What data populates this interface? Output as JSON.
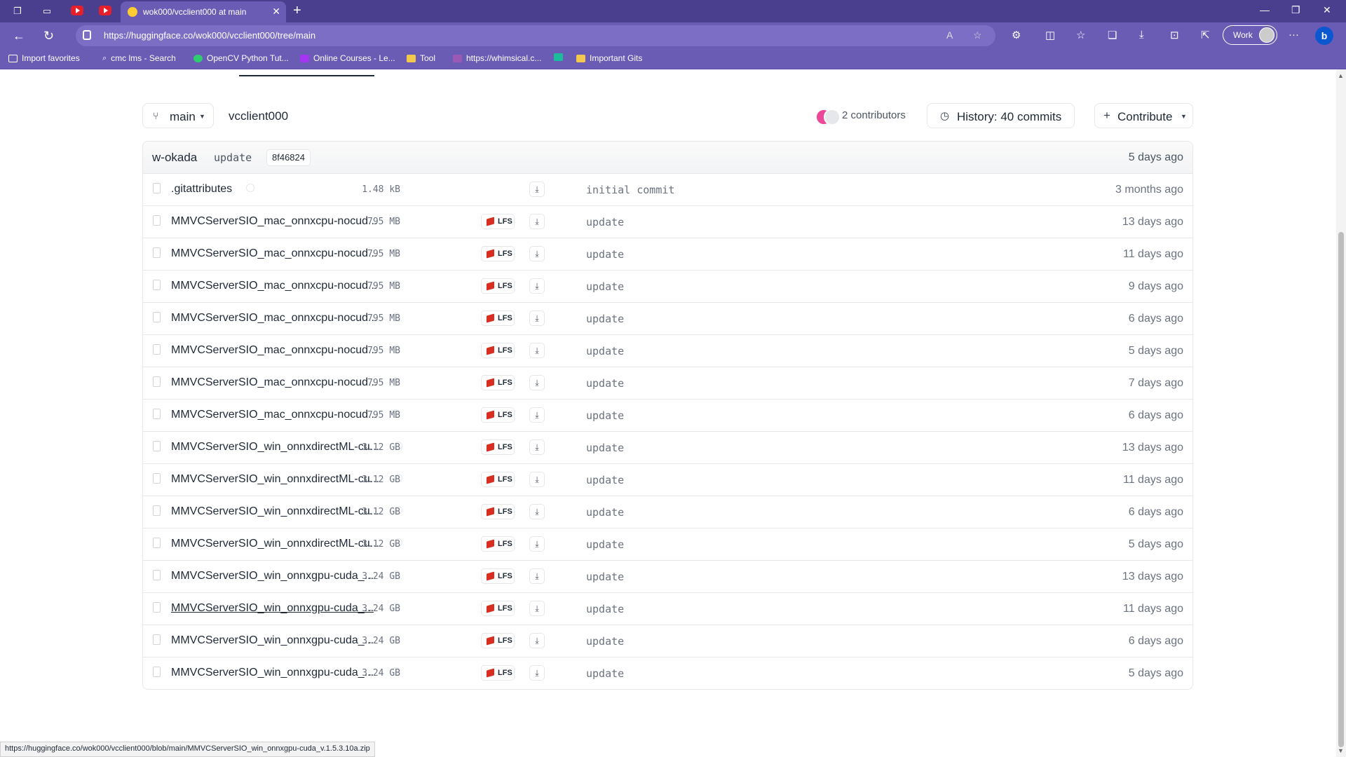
{
  "browser": {
    "tab_title": "wok000/vcclient000 at main",
    "url": "https://huggingface.co/wok000/vcclient000/tree/main",
    "profile_label": "Work",
    "bookmarks": [
      {
        "label": "Import favorites",
        "icon": "import-icon"
      },
      {
        "label": "cmc lms - Search",
        "icon": "search-icon"
      },
      {
        "label": "OpenCV Python Tut...",
        "icon": "opencv-icon"
      },
      {
        "label": "Online Courses - Le...",
        "icon": "udemy-icon"
      },
      {
        "label": "Tool",
        "icon": "folder-icon"
      },
      {
        "label": "https://whimsical.c...",
        "icon": "whimsical-icon"
      },
      {
        "label": "",
        "icon": "app-icon"
      },
      {
        "label": "Important Gits",
        "icon": "folder-icon"
      }
    ]
  },
  "repo": {
    "branch": "main",
    "name": "vcclient000",
    "contributors": "2 contributors",
    "history": "History: 40 commits",
    "contribute": "Contribute"
  },
  "last_commit": {
    "author": "w-okada",
    "message": "update",
    "sha": "8f46824",
    "date": "5 days ago"
  },
  "files": [
    {
      "name": ".gitattributes",
      "size": "1.48 kB",
      "lfs": false,
      "commit": "initial commit",
      "date": "3 months ago"
    },
    {
      "name": "MMVCServerSIO_mac_onnxcpu-nocud...",
      "size": "795 MB",
      "lfs": true,
      "commit": "update",
      "date": "13 days ago"
    },
    {
      "name": "MMVCServerSIO_mac_onnxcpu-nocud...",
      "size": "795 MB",
      "lfs": true,
      "commit": "update",
      "date": "11 days ago"
    },
    {
      "name": "MMVCServerSIO_mac_onnxcpu-nocud...",
      "size": "795 MB",
      "lfs": true,
      "commit": "update",
      "date": "9 days ago"
    },
    {
      "name": "MMVCServerSIO_mac_onnxcpu-nocud...",
      "size": "795 MB",
      "lfs": true,
      "commit": "update",
      "date": "6 days ago"
    },
    {
      "name": "MMVCServerSIO_mac_onnxcpu-nocud...",
      "size": "795 MB",
      "lfs": true,
      "commit": "update",
      "date": "5 days ago"
    },
    {
      "name": "MMVCServerSIO_mac_onnxcpu-nocud...",
      "size": "795 MB",
      "lfs": true,
      "commit": "update",
      "date": "7 days ago"
    },
    {
      "name": "MMVCServerSIO_mac_onnxcpu-nocud...",
      "size": "795 MB",
      "lfs": true,
      "commit": "update",
      "date": "6 days ago"
    },
    {
      "name": "MMVCServerSIO_win_onnxdirectML-cu...",
      "size": "3.12 GB",
      "lfs": true,
      "commit": "update",
      "date": "13 days ago"
    },
    {
      "name": "MMVCServerSIO_win_onnxdirectML-cu...",
      "size": "3.12 GB",
      "lfs": true,
      "commit": "update",
      "date": "11 days ago"
    },
    {
      "name": "MMVCServerSIO_win_onnxdirectML-cu...",
      "size": "3.12 GB",
      "lfs": true,
      "commit": "update",
      "date": "6 days ago"
    },
    {
      "name": "MMVCServerSIO_win_onnxdirectML-cu...",
      "size": "3.12 GB",
      "lfs": true,
      "commit": "update",
      "date": "5 days ago"
    },
    {
      "name": "MMVCServerSIO_win_onnxgpu-cuda_...",
      "size": "3.24 GB",
      "lfs": true,
      "commit": "update",
      "date": "13 days ago"
    },
    {
      "name": "MMVCServerSIO_win_onnxgpu-cuda_...",
      "size": "3.24 GB",
      "lfs": true,
      "commit": "update",
      "date": "11 days ago",
      "hovered": true
    },
    {
      "name": "MMVCServerSIO_win_onnxgpu-cuda_...",
      "size": "3.24 GB",
      "lfs": true,
      "commit": "update",
      "date": "6 days ago"
    },
    {
      "name": "MMVCServerSIO_win_onnxgpu-cuda_...",
      "size": "3.24 GB",
      "lfs": true,
      "commit": "update",
      "date": "5 days ago"
    }
  ],
  "lfs_label": "LFS",
  "status_url": "https://huggingface.co/wok000/vcclient000/blob/main/MMVCServerSIO_win_onnxgpu-cuda_v.1.5.3.10a.zip"
}
